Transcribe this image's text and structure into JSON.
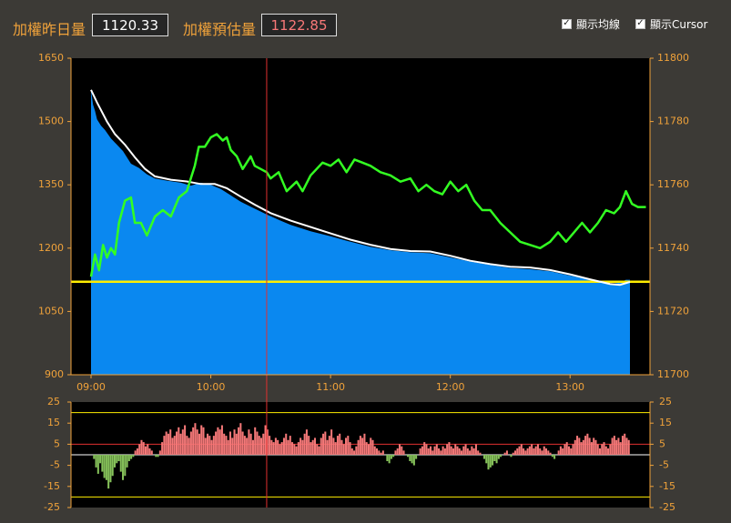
{
  "header": {
    "prev_label": "加權昨日量",
    "prev_value": "1120.33",
    "est_label": "加權預估量",
    "est_value": "1122.85",
    "checkbox_avg": "顯示均線",
    "checkbox_cursor": "顯示Cursor"
  },
  "colors": {
    "label": "#f0a23a",
    "volume_fill": "#0a88f0",
    "avg_line": "#ffffff",
    "index_line": "#33ff22",
    "ref_line": "#ffee00",
    "cursor": "#e03030",
    "bar_pos": "#f47878",
    "bar_neg": "#86c25a",
    "est_value": "#f87878"
  },
  "chart_data": [
    {
      "type": "area",
      "x_ticks": [
        "09:00",
        "10:00",
        "11:00",
        "12:00",
        "13:00"
      ],
      "y_left_ticks": [
        900,
        1050,
        1200,
        1350,
        1500,
        1650
      ],
      "y_right_ticks": [
        11700,
        11720,
        11740,
        11760,
        11780,
        11800
      ],
      "ylim_left": [
        900,
        1650
      ],
      "ylim_right": [
        11700,
        11800
      ],
      "x_minutes_range": [
        0,
        270
      ],
      "reference_value": 1120.33,
      "cursor_minute": 88,
      "series": [
        {
          "axis": "left",
          "style": "filled-area",
          "points": [
            [
              0,
              1575
            ],
            [
              1,
              1540
            ],
            [
              2,
              1525
            ],
            [
              3,
              1505
            ],
            [
              5,
              1490
            ],
            [
              7,
              1480
            ],
            [
              10,
              1460
            ],
            [
              13,
              1445
            ],
            [
              16,
              1430
            ],
            [
              20,
              1400
            ],
            [
              24,
              1390
            ],
            [
              28,
              1375
            ],
            [
              32,
              1365
            ],
            [
              38,
              1360
            ],
            [
              45,
              1355
            ],
            [
              50,
              1348
            ],
            [
              55,
              1355
            ],
            [
              60,
              1350
            ],
            [
              65,
              1340
            ],
            [
              70,
              1325
            ],
            [
              75,
              1310
            ],
            [
              80,
              1298
            ],
            [
              88,
              1280
            ],
            [
              95,
              1265
            ],
            [
              100,
              1255
            ],
            [
              110,
              1240
            ],
            [
              120,
              1228
            ],
            [
              130,
              1215
            ],
            [
              140,
              1203
            ],
            [
              150,
              1195
            ],
            [
              160,
              1190
            ],
            [
              170,
              1188
            ],
            [
              180,
              1178
            ],
            [
              190,
              1168
            ],
            [
              200,
              1160
            ],
            [
              210,
              1153
            ],
            [
              220,
              1150
            ],
            [
              230,
              1145
            ],
            [
              240,
              1135
            ],
            [
              250,
              1125
            ],
            [
              255,
              1118
            ],
            [
              260,
              1115
            ],
            [
              265,
              1118
            ],
            [
              268,
              1125
            ],
            [
              270,
              1125
            ]
          ]
        },
        {
          "axis": "left",
          "style": "average-line",
          "points": [
            [
              0,
              1575
            ],
            [
              3,
              1545
            ],
            [
              8,
              1500
            ],
            [
              12,
              1470
            ],
            [
              17,
              1445
            ],
            [
              22,
              1415
            ],
            [
              27,
              1388
            ],
            [
              32,
              1370
            ],
            [
              40,
              1362
            ],
            [
              48,
              1358
            ],
            [
              55,
              1352
            ],
            [
              62,
              1352
            ],
            [
              68,
              1342
            ],
            [
              75,
              1322
            ],
            [
              82,
              1303
            ],
            [
              90,
              1283
            ],
            [
              100,
              1265
            ],
            [
              110,
              1250
            ],
            [
              120,
              1235
            ],
            [
              130,
              1220
            ],
            [
              140,
              1208
            ],
            [
              150,
              1198
            ],
            [
              160,
              1193
            ],
            [
              170,
              1192
            ],
            [
              180,
              1182
            ],
            [
              190,
              1170
            ],
            [
              200,
              1162
            ],
            [
              210,
              1156
            ],
            [
              220,
              1154
            ],
            [
              230,
              1148
            ],
            [
              240,
              1138
            ],
            [
              250,
              1126
            ],
            [
              260,
              1115
            ],
            [
              265,
              1113
            ],
            [
              270,
              1120
            ]
          ]
        },
        {
          "axis": "right",
          "style": "index-line",
          "points": [
            [
              0,
              11731
            ],
            [
              2,
              11738
            ],
            [
              4,
              11733
            ],
            [
              6,
              11741
            ],
            [
              8,
              11737
            ],
            [
              10,
              11740
            ],
            [
              12,
              11738
            ],
            [
              14,
              11748
            ],
            [
              17,
              11755
            ],
            [
              20,
              11756
            ],
            [
              22,
              11748
            ],
            [
              25,
              11748
            ],
            [
              28,
              11744
            ],
            [
              32,
              11750
            ],
            [
              36,
              11752
            ],
            [
              40,
              11750
            ],
            [
              44,
              11756
            ],
            [
              48,
              11758
            ],
            [
              50,
              11762
            ],
            [
              52,
              11766
            ],
            [
              54,
              11772
            ],
            [
              57,
              11772
            ],
            [
              60,
              11775
            ],
            [
              63,
              11776
            ],
            [
              66,
              11774
            ],
            [
              68,
              11775
            ],
            [
              70,
              11771
            ],
            [
              73,
              11769
            ],
            [
              76,
              11765
            ],
            [
              80,
              11769
            ],
            [
              82,
              11766
            ],
            [
              85,
              11765
            ],
            [
              88,
              11764
            ],
            [
              90,
              11762
            ],
            [
              94,
              11764
            ],
            [
              98,
              11758
            ],
            [
              103,
              11761
            ],
            [
              106,
              11758
            ],
            [
              110,
              11763
            ],
            [
              113,
              11765
            ],
            [
              116,
              11767
            ],
            [
              120,
              11766
            ],
            [
              124,
              11768
            ],
            [
              128,
              11764
            ],
            [
              132,
              11768
            ],
            [
              136,
              11767
            ],
            [
              140,
              11766
            ],
            [
              145,
              11764
            ],
            [
              150,
              11763
            ],
            [
              155,
              11761
            ],
            [
              160,
              11762
            ],
            [
              164,
              11758
            ],
            [
              168,
              11760
            ],
            [
              172,
              11758
            ],
            [
              176,
              11757
            ],
            [
              180,
              11761
            ],
            [
              184,
              11758
            ],
            [
              188,
              11760
            ],
            [
              192,
              11755
            ],
            [
              196,
              11752
            ],
            [
              200,
              11752
            ],
            [
              205,
              11748
            ],
            [
              210,
              11745
            ],
            [
              215,
              11742
            ],
            [
              220,
              11741
            ],
            [
              225,
              11740
            ],
            [
              230,
              11742
            ],
            [
              234,
              11745
            ],
            [
              238,
              11742
            ],
            [
              242,
              11745
            ],
            [
              246,
              11748
            ],
            [
              250,
              11745
            ],
            [
              254,
              11748
            ],
            [
              258,
              11752
            ],
            [
              262,
              11751
            ],
            [
              265,
              11753
            ],
            [
              268,
              11758
            ],
            [
              271,
              11754
            ],
            [
              274,
              11753
            ],
            [
              278,
              11753
            ]
          ]
        }
      ]
    },
    {
      "type": "bar",
      "y_ticks": [
        25,
        15,
        5,
        -5,
        -15,
        -25
      ],
      "ylim": [
        -25,
        25
      ],
      "values": [
        0,
        -2,
        -6,
        -9,
        -4,
        -8,
        -11,
        -12,
        -16,
        -13,
        -10,
        -6,
        -4,
        -3,
        -8,
        -12,
        -10,
        -6,
        -3,
        -2,
        -1,
        2,
        3,
        5,
        7,
        6,
        4,
        5,
        3,
        2,
        0,
        -1,
        -1,
        2,
        6,
        9,
        11,
        10,
        12,
        8,
        9,
        11,
        13,
        10,
        12,
        14,
        9,
        8,
        11,
        13,
        15,
        12,
        10,
        14,
        13,
        8,
        10,
        9,
        7,
        9,
        11,
        13,
        12,
        14,
        10,
        9,
        7,
        11,
        8,
        12,
        10,
        13,
        15,
        11,
        9,
        8,
        12,
        10,
        7,
        13,
        11,
        9,
        8,
        10,
        14,
        12,
        9,
        7,
        6,
        8,
        7,
        5,
        6,
        8,
        10,
        7,
        9,
        6,
        5,
        4,
        6,
        8,
        7,
        10,
        12,
        9,
        6,
        7,
        8,
        5,
        4,
        8,
        10,
        11,
        7,
        9,
        12,
        8,
        6,
        9,
        10,
        7,
        5,
        8,
        9,
        6,
        3,
        2,
        4,
        7,
        9,
        8,
        10,
        6,
        5,
        8,
        7,
        4,
        3,
        2,
        1,
        2,
        0,
        -3,
        -4,
        -2,
        -1,
        2,
        3,
        5,
        4,
        2,
        0,
        -1,
        -3,
        -4,
        -5,
        -2,
        0,
        3,
        4,
        6,
        5,
        3,
        4,
        2,
        4,
        5,
        3,
        2,
        4,
        3,
        5,
        6,
        4,
        3,
        5,
        4,
        3,
        2,
        4,
        5,
        3,
        2,
        4,
        3,
        5,
        2,
        1,
        0,
        -2,
        -4,
        -7,
        -6,
        -5,
        -3,
        -4,
        -2,
        -1,
        0,
        1,
        2,
        0,
        -1,
        1,
        2,
        3,
        4,
        5,
        3,
        2,
        3,
        4,
        5,
        3,
        4,
        5,
        3,
        2,
        4,
        3,
        2,
        1,
        -1,
        -2,
        0,
        2,
        4,
        3,
        5,
        6,
        4,
        3,
        5,
        7,
        9,
        8,
        6,
        7,
        9,
        10,
        8,
        6,
        8,
        7,
        5,
        3,
        5,
        6,
        4,
        3,
        5,
        8,
        9,
        7,
        8,
        6,
        9,
        10,
        8,
        7
      ]
    }
  ]
}
